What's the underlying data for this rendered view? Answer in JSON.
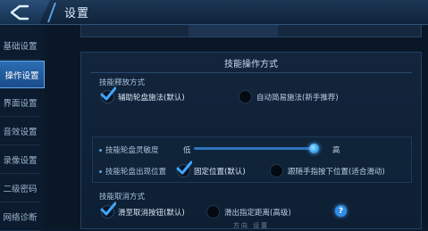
{
  "header": {
    "title": "设置"
  },
  "sidebar": {
    "items": [
      {
        "label": "基础设置"
      },
      {
        "label": "操作设置",
        "active": true
      },
      {
        "label": "界面设置"
      },
      {
        "label": "音效设置"
      },
      {
        "label": "录像设置"
      },
      {
        "label": "二级密码"
      },
      {
        "label": "网络诊断"
      }
    ]
  },
  "section": {
    "title": "技能操作方式",
    "release": {
      "label": "技能释放方式",
      "options": [
        {
          "label": "辅助轮盘施法(默认)",
          "checked": true
        },
        {
          "label": "自动简易施法(新手推荐)",
          "checked": false
        }
      ]
    },
    "sensitivity": {
      "label": "技能轮盘灵敏度",
      "low": "低",
      "high": "高",
      "level": 1.0
    },
    "wheel_position": {
      "label": "技能轮盘出现位置",
      "options": [
        {
          "label": "固定位置(默认)",
          "checked": true
        },
        {
          "label": "跟随手指按下位置(适合滑动)",
          "checked": false
        }
      ]
    },
    "cancel": {
      "label": "技能取消方式",
      "options": [
        {
          "label": "滑至取消按钮(默认)",
          "checked": true
        },
        {
          "label": "滑出指定距离(高级)",
          "checked": false
        }
      ],
      "help": "?"
    },
    "footer": "方向 设置"
  },
  "colors": {
    "accent": "#2f8fe6",
    "active_tab": "#2b6db4"
  }
}
